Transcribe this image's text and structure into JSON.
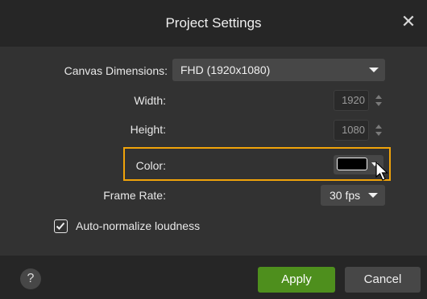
{
  "dialog": {
    "title": "Project Settings",
    "close_glyph": "✕"
  },
  "canvas": {
    "label": "Canvas Dimensions:",
    "selected": "FHD (1920x1080)"
  },
  "width": {
    "label": "Width:",
    "value": "1920"
  },
  "height": {
    "label": "Height:",
    "value": "1080"
  },
  "color": {
    "label": "Color:",
    "swatch": "#000000",
    "highlight": "#f0a30a"
  },
  "frame_rate": {
    "label": "Frame Rate:",
    "selected": "30 fps"
  },
  "auto_normalize": {
    "label": "Auto-normalize loudness",
    "checked": true
  },
  "footer": {
    "help_glyph": "?",
    "apply_label": "Apply",
    "cancel_label": "Cancel"
  },
  "colors": {
    "accent_apply": "#4e8f1d",
    "title_bar": "#262626",
    "body": "#323232"
  }
}
